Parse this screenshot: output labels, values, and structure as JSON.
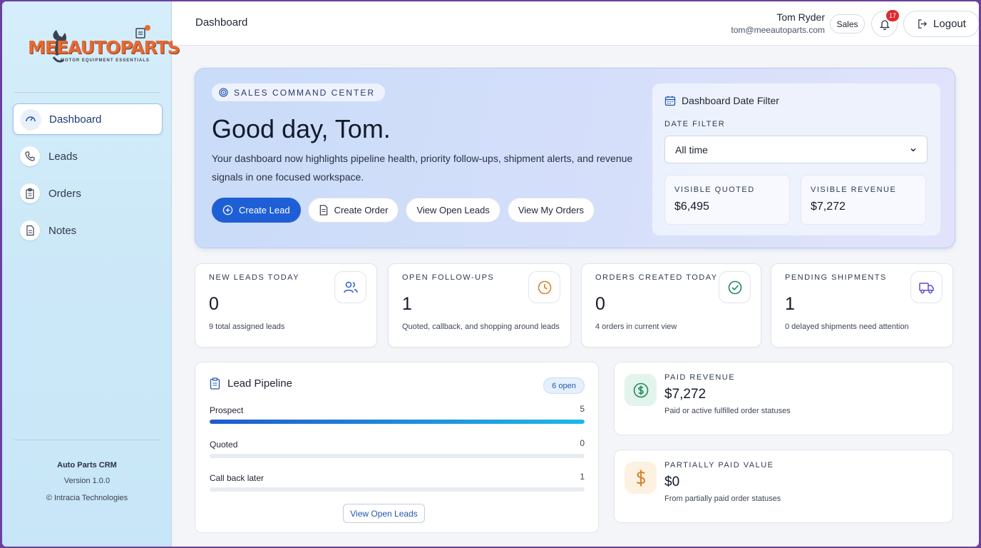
{
  "brand": {
    "name": "MEEAUTOPARTS",
    "tagline": "MOTOR EQUIPMENT ESSENTIALS"
  },
  "sidebar": {
    "items": [
      {
        "label": "Dashboard",
        "icon": "gauge-icon",
        "active": true
      },
      {
        "label": "Leads",
        "icon": "phone-icon"
      },
      {
        "label": "Orders",
        "icon": "clipboard-icon"
      },
      {
        "label": "Notes",
        "icon": "document-icon"
      }
    ],
    "footer": {
      "app": "Auto Parts CRM",
      "version": "Version 1.0.0",
      "copyright": "© Intracia Technologies"
    }
  },
  "topbar": {
    "title": "Dashboard",
    "user_name": "Tom Ryder",
    "user_email": "tom@meeautoparts.com",
    "role": "Sales",
    "notifications": "17",
    "logout": "Logout"
  },
  "hero": {
    "tag": "SALES COMMAND CENTER",
    "greeting": "Good day, Tom.",
    "description": "Your dashboard now highlights pipeline health, priority follow-ups, shipment alerts, and revenue signals in one focused workspace.",
    "actions": {
      "create_lead": "Create Lead",
      "create_order": "Create Order",
      "view_open_leads": "View Open Leads",
      "view_my_orders": "View My Orders"
    }
  },
  "date_filter": {
    "title": "Dashboard Date Filter",
    "label": "DATE FILTER",
    "selected": "All time",
    "quoted_label": "VISIBLE QUOTED",
    "quoted_value": "$6,495",
    "revenue_label": "VISIBLE REVENUE",
    "revenue_value": "$7,272"
  },
  "stats": [
    {
      "label": "NEW LEADS TODAY",
      "value": "0",
      "sub": "9 total assigned leads",
      "icon": "users-icon",
      "color": "#2d5fc4"
    },
    {
      "label": "OPEN FOLLOW-UPS",
      "value": "1",
      "sub": "Quoted, callback, and shopping around leads",
      "icon": "clock-icon",
      "color": "#d9822b"
    },
    {
      "label": "ORDERS CREATED TODAY",
      "value": "0",
      "sub": "4 orders in current view",
      "icon": "check-circle-icon",
      "color": "#1e8a5a"
    },
    {
      "label": "PENDING SHIPMENTS",
      "value": "1",
      "sub": "0 delayed shipments need attention",
      "icon": "truck-icon",
      "color": "#5a4fd0"
    }
  ],
  "pipeline": {
    "title": "Lead Pipeline",
    "open_badge": "6 open",
    "rows": [
      {
        "label": "Prospect",
        "count": "5",
        "fill": 1.0
      },
      {
        "label": "Quoted",
        "count": "0",
        "fill": 0
      },
      {
        "label": "Call back later",
        "count": "1",
        "fill": 0
      }
    ],
    "button": "View Open Leads"
  },
  "revenue": [
    {
      "label": "PAID REVENUE",
      "value": "$7,272",
      "sub": "Paid or active fulfilled order statuses",
      "icon": "dollar-circle-icon",
      "color": "#1e8a5a"
    },
    {
      "label": "PARTIALLY PAID VALUE",
      "value": "$0",
      "sub": "From partially paid order statuses",
      "icon": "dollar-icon",
      "color": "#d9822b"
    }
  ]
}
